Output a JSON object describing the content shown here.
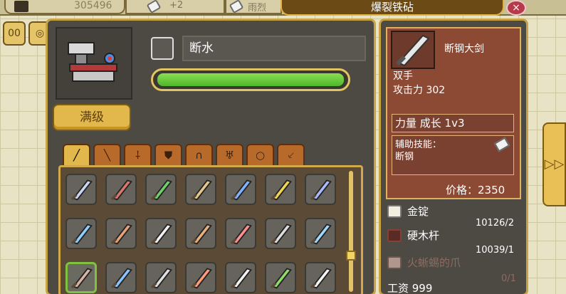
{
  "topbar": {
    "gold": "305496",
    "chip_a": "+2",
    "chip_b": "雨烈"
  },
  "title": "爆裂铁砧",
  "close_label": "×",
  "mini_buttons": [
    {
      "label": "00"
    },
    {
      "label": "◎"
    }
  ],
  "craft": {
    "name": "断水",
    "progress": 1.0,
    "max_level_label": "满级"
  },
  "tabs": [
    {
      "icon": "sword-icon",
      "glyph": "╱"
    },
    {
      "icon": "spear-icon",
      "glyph": "╲"
    },
    {
      "icon": "axe-icon",
      "glyph": "⸸"
    },
    {
      "icon": "shield-icon",
      "glyph": "⛊"
    },
    {
      "icon": "helmet-icon",
      "glyph": "∩"
    },
    {
      "icon": "armor-icon",
      "glyph": "♅"
    },
    {
      "icon": "ring-icon",
      "glyph": "○"
    },
    {
      "icon": "pickaxe-icon",
      "glyph": "⸔"
    }
  ],
  "weapon_grid": [
    {
      "icon": "sword-icon",
      "color": "#c9d6f2"
    },
    {
      "icon": "sword-icon",
      "color": "#d9776f"
    },
    {
      "icon": "sword-icon",
      "color": "#6fcf6a"
    },
    {
      "icon": "sword-icon",
      "color": "#e6c78a"
    },
    {
      "icon": "sword-icon",
      "color": "#7fb2ff"
    },
    {
      "icon": "sword-icon",
      "color": "#f2d44e"
    },
    {
      "icon": "sword-icon",
      "color": "#a9b9ff"
    },
    {
      "icon": "sword-icon",
      "color": "#8fd0ff"
    },
    {
      "icon": "sword-icon",
      "color": "#e9a17a"
    },
    {
      "icon": "sword-icon",
      "color": "#f2f2f2"
    },
    {
      "icon": "sword-icon",
      "color": "#e8b07d"
    },
    {
      "icon": "sword-icon",
      "color": "#ff8f8f"
    },
    {
      "icon": "sword-icon",
      "color": "#dddddd"
    },
    {
      "icon": "sword-icon",
      "color": "#9fd9ff"
    },
    {
      "icon": "sword-icon",
      "color": "#d8b4a4"
    },
    {
      "icon": "sword-icon",
      "color": "#89c4ff"
    },
    {
      "icon": "sword-icon",
      "color": "#e0e0e0"
    },
    {
      "icon": "sword-icon",
      "color": "#ff9b7a"
    },
    {
      "icon": "sword-icon",
      "color": "#f2f2f2"
    },
    {
      "icon": "sword-icon",
      "color": "#8edb6a"
    },
    {
      "icon": "sword-icon",
      "color": "#f5f5f5"
    }
  ],
  "info": {
    "item_name": "断钢大剑",
    "hand_type": "双手",
    "attack": "攻击力 302",
    "growth": "力量 成长 1v3",
    "skill_title": "辅助技能：",
    "skill_name": "断钢",
    "price": "价格：2350"
  },
  "materials": [
    {
      "name": "金锭",
      "count": "10126/2",
      "icon": "gold-ingot-icon",
      "color": "#f2efe0"
    },
    {
      "name": "硬木杆",
      "count": "10039/1",
      "icon": "wooden-rod-icon",
      "color": "#8a3e34"
    },
    {
      "name": "火蜥蜴的爪",
      "count": "0/1",
      "icon": "claw-icon",
      "color": "#b0968c"
    },
    {
      "name": "工资 999",
      "count": "",
      "icon": "",
      "color": ""
    }
  ],
  "arrow_label": "▷▷"
}
